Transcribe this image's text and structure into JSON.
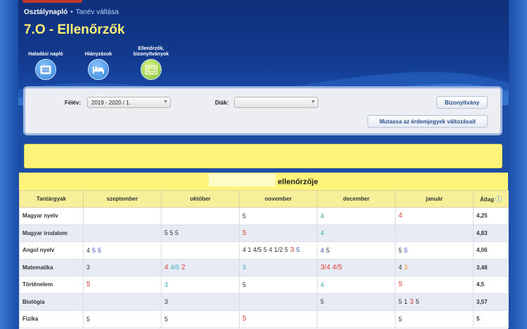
{
  "header": {
    "breadcrumb_main": "Osztálynapló",
    "breadcrumb_link": "Tanév váltása",
    "title": "7.O - Ellenőrzők"
  },
  "nav": [
    {
      "label": "Haladási napló",
      "icon": "list-icon",
      "active": false
    },
    {
      "label": "Hiányzások",
      "icon": "bed-icon",
      "active": false
    },
    {
      "label": "Ellenőrzők, bizonyítványok",
      "icon": "certificate-icon",
      "active": true
    }
  ],
  "filters": {
    "semester_label": "Félév:",
    "semester_value": "2019 - 2020 / 1.",
    "student_label": "Diák:",
    "student_value": "",
    "certificate_button": "Bizonyítvány",
    "changes_button": "Mutassa az érdemjegyek változásait"
  },
  "table": {
    "caption_suffix": "ellenőrzője",
    "headers": [
      "Tantárgyak",
      "szeptember",
      "október",
      "november",
      "december",
      "január",
      "Átlag"
    ],
    "rows": [
      {
        "subject": "Magyar nyelv",
        "cells": [
          [],
          [],
          [
            [
              "5",
              "dark"
            ]
          ],
          [
            [
              "4",
              "teal"
            ]
          ],
          [
            [
              "4",
              "red"
            ]
          ]
        ],
        "avg": "4,25"
      },
      {
        "subject": "Magyar irodalom",
        "cells": [
          [],
          [
            [
              "5 5 5",
              "dark"
            ]
          ],
          [
            [
              "5",
              "red"
            ]
          ],
          [
            [
              "4",
              "teal"
            ]
          ],
          []
        ],
        "avg": "4,83"
      },
      {
        "subject": "Angol nyelv",
        "cells": [
          [
            [
              "4",
              "dark"
            ],
            [
              "5",
              "blue"
            ],
            [
              "5",
              "blue"
            ]
          ],
          [],
          [
            [
              "4 1 4/5 5 4 1/2 5",
              "dark"
            ],
            [
              "3",
              "red"
            ],
            [
              "5",
              "blue"
            ]
          ],
          [
            [
              "4",
              "blue"
            ],
            [
              "5",
              "dark"
            ]
          ],
          [
            [
              "5",
              "dark"
            ],
            [
              "5",
              "blue"
            ]
          ]
        ],
        "avg": "4,06"
      },
      {
        "subject": "Matematika",
        "cells": [
          [
            [
              "3",
              "dark"
            ]
          ],
          [
            [
              "4",
              "red"
            ],
            [
              "4/5",
              "teal"
            ],
            [
              "2",
              "red"
            ]
          ],
          [
            [
              "3",
              "teal"
            ]
          ],
          [
            [
              "3/4",
              "red"
            ],
            [
              "4/5",
              "red"
            ]
          ],
          [
            [
              "4",
              "dark"
            ],
            [
              "3",
              "orange"
            ]
          ]
        ],
        "avg": "3,48"
      },
      {
        "subject": "Történelem",
        "cells": [
          [
            [
              "5",
              "red"
            ]
          ],
          [
            [
              "3",
              "teal"
            ]
          ],
          [
            [
              "5",
              "dark"
            ]
          ],
          [
            [
              "4",
              "teal"
            ]
          ],
          [
            [
              "5",
              "red"
            ]
          ]
        ],
        "avg": "4,5"
      },
      {
        "subject": "Biológia",
        "cells": [
          [],
          [
            [
              "3",
              "dark"
            ]
          ],
          [],
          [
            [
              "5",
              "dark"
            ]
          ],
          [
            [
              "5",
              "dark"
            ],
            [
              "1",
              "dark"
            ],
            [
              "3",
              "red"
            ],
            [
              "5",
              "dark"
            ]
          ]
        ],
        "avg": "3,57"
      },
      {
        "subject": "Fizika",
        "cells": [
          [
            [
              "5",
              "dark"
            ]
          ],
          [
            [
              "5",
              "dark"
            ]
          ],
          [
            [
              "5",
              "red"
            ]
          ],
          [],
          [
            [
              "5",
              "dark"
            ]
          ]
        ],
        "avg": "5"
      }
    ]
  }
}
